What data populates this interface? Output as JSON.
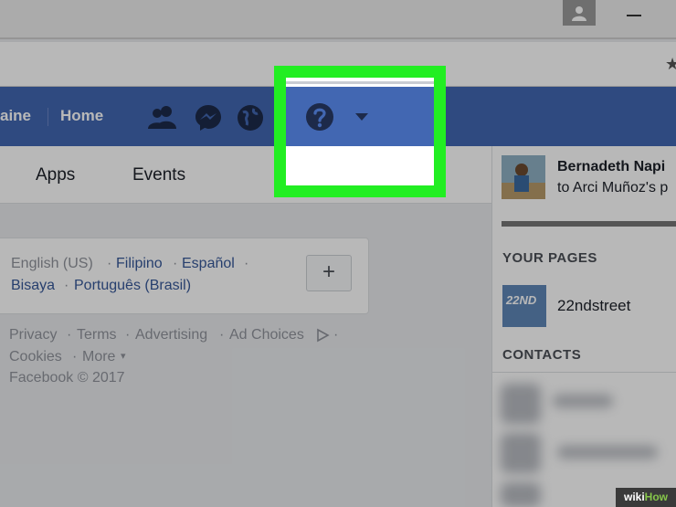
{
  "nav": {
    "profile_partial": "aine",
    "home": "Home"
  },
  "tabs": [
    "Apps",
    "Events"
  ],
  "languages": {
    "current": "English (US)",
    "sep": "·",
    "filipino": "Filipino",
    "espanol": "Español",
    "bisaya": "Bisaya",
    "portugues": "Português (Brasil)",
    "add_label": "+"
  },
  "footer": {
    "privacy": "Privacy",
    "terms": "Terms",
    "advertising": "Advertising",
    "ad_choices": "Ad Choices",
    "cookies": "Cookies",
    "more": "More",
    "copyright": "Facebook © 2017"
  },
  "sidebar": {
    "notification_name": "Bernadeth Napi",
    "notification_text": "to Arci Muñoz's p",
    "your_pages_header": "YOUR PAGES",
    "page_name": "22ndstreet",
    "page_thumb_text": "22ND",
    "contacts_header": "CONTACTS"
  },
  "watermark": {
    "wiki": "wiki",
    "how": "How"
  },
  "colors": {
    "fb_blue": "#4267b2",
    "highlight_green": "#22ee22",
    "link_blue": "#365899"
  }
}
